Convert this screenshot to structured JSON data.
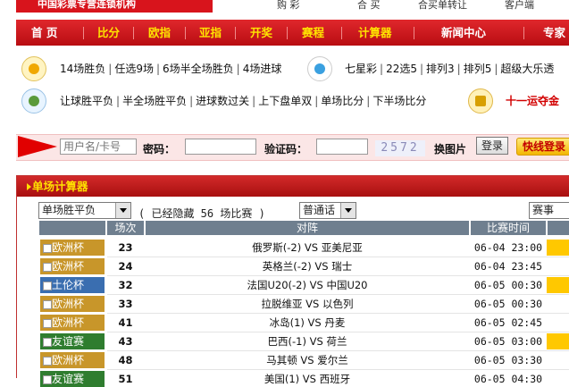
{
  "header": {
    "logo_text": "中国彩票专营连锁机构",
    "top_links": [
      "购 彩",
      "合 买",
      "合买单转让",
      "客户端"
    ]
  },
  "nav": {
    "items": [
      {
        "label": "首 页",
        "highlight": false
      },
      {
        "label": "比分",
        "highlight": true
      },
      {
        "label": "欧指",
        "highlight": true
      },
      {
        "label": "亚指",
        "highlight": true
      },
      {
        "label": "开奖",
        "highlight": true
      },
      {
        "label": "赛程",
        "highlight": true
      },
      {
        "label": "计算器",
        "highlight": true
      },
      {
        "label": "新闻中心",
        "highlight": false
      },
      {
        "label": "专家",
        "highlight": false
      }
    ]
  },
  "lottery": {
    "row1_left": [
      "14场胜负",
      "任选9场",
      "6场半全场胜负",
      "4场进球"
    ],
    "row1_right": [
      "七星彩",
      "22选5",
      "排列3",
      "排列5",
      "超级大乐透"
    ],
    "row2_left": [
      "让球胜平负",
      "半全场胜平负",
      "进球数过关",
      "上下盘单双",
      "单场比分",
      "下半场比分"
    ],
    "row2_right_highlight": "十一运夺金"
  },
  "login": {
    "username_placeholder": "用户名/卡号",
    "password_label": "密码：",
    "captcha_label": "验证码：",
    "captcha_code": "2572",
    "change_image": "换图片",
    "login_button": "登录",
    "quick_login": "快线登录"
  },
  "calculator": {
    "title": "单场计算器",
    "play_type": "单场胜平负",
    "hidden_note": "( 已经隐藏 56 场比赛 )",
    "mode": "普通话",
    "event_filter": "赛事",
    "columns": [
      "场次",
      "对阵",
      "比赛时间"
    ],
    "rows": [
      {
        "league": "欧洲杯",
        "color": "#c8962a",
        "no": "23",
        "match": "俄罗斯(-2) VS 亚美尼亚",
        "time": "06-04 23:00",
        "flag": true
      },
      {
        "league": "欧洲杯",
        "color": "#c8962a",
        "no": "24",
        "match": "英格兰(-2) VS 瑞士",
        "time": "06-04 23:45",
        "flag": false
      },
      {
        "league": "土伦杯",
        "color": "#3a6eb0",
        "no": "32",
        "match": "法国U20(-2) VS 中国U20",
        "time": "06-05 00:30",
        "flag": true
      },
      {
        "league": "欧洲杯",
        "color": "#c8962a",
        "no": "33",
        "match": "拉脱维亚 VS 以色列",
        "time": "06-05 00:30",
        "flag": false
      },
      {
        "league": "欧洲杯",
        "color": "#c8962a",
        "no": "41",
        "match": "冰岛(1) VS 丹麦",
        "time": "06-05 02:45",
        "flag": false
      },
      {
        "league": "友谊赛",
        "color": "#2f7d2f",
        "no": "43",
        "match": "巴西(-1) VS 荷兰",
        "time": "06-05 03:00",
        "flag": true
      },
      {
        "league": "欧洲杯",
        "color": "#c8962a",
        "no": "48",
        "match": "马其顿 VS 爱尔兰",
        "time": "06-05 03:30",
        "flag": false
      },
      {
        "league": "友谊赛",
        "color": "#2f7d2f",
        "no": "51",
        "match": "美国(1) VS 西班牙",
        "time": "06-05 04:30",
        "flag": false
      }
    ]
  }
}
